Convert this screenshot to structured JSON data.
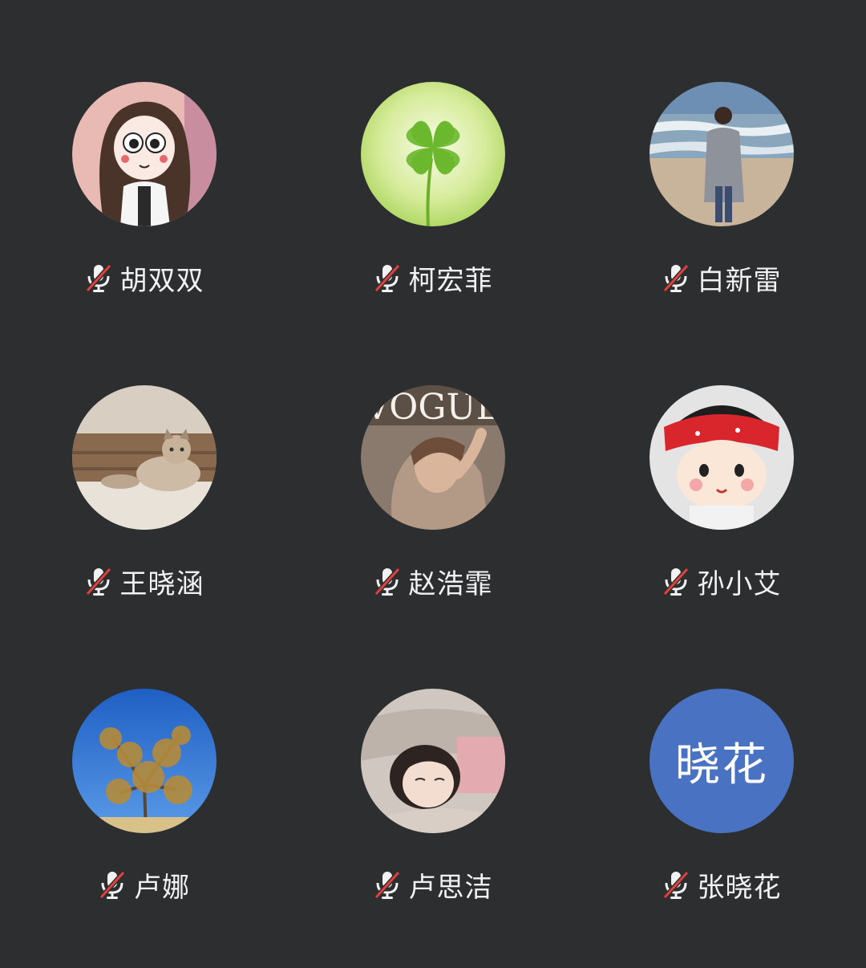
{
  "participants": [
    {
      "name": "胡双双",
      "muted": true,
      "avatar": "cartoon-girl-avatar"
    },
    {
      "name": "柯宏菲",
      "muted": true,
      "avatar": "four-leaf-clover-avatar"
    },
    {
      "name": "白新雷",
      "muted": true,
      "avatar": "beach-woman-avatar"
    },
    {
      "name": "王晓涵",
      "muted": true,
      "avatar": "cat-avatar"
    },
    {
      "name": "赵浩霏",
      "muted": true,
      "avatar": "magazine-cover-avatar"
    },
    {
      "name": "孙小艾",
      "muted": true,
      "avatar": "cartoon-bandana-avatar"
    },
    {
      "name": "卢娜",
      "muted": true,
      "avatar": "tree-sky-avatar"
    },
    {
      "name": "卢思洁",
      "muted": true,
      "avatar": "girl-lying-avatar"
    },
    {
      "name": "张晓花",
      "muted": true,
      "avatar_initials": "晓花",
      "avatar_color": "#4a72c2"
    }
  ],
  "colors": {
    "background": "#2d2e30",
    "mute_slash": "#e0413b",
    "mic_body": "#f2f2f2"
  },
  "icons": {
    "muted_mic": "mic-off-icon"
  }
}
